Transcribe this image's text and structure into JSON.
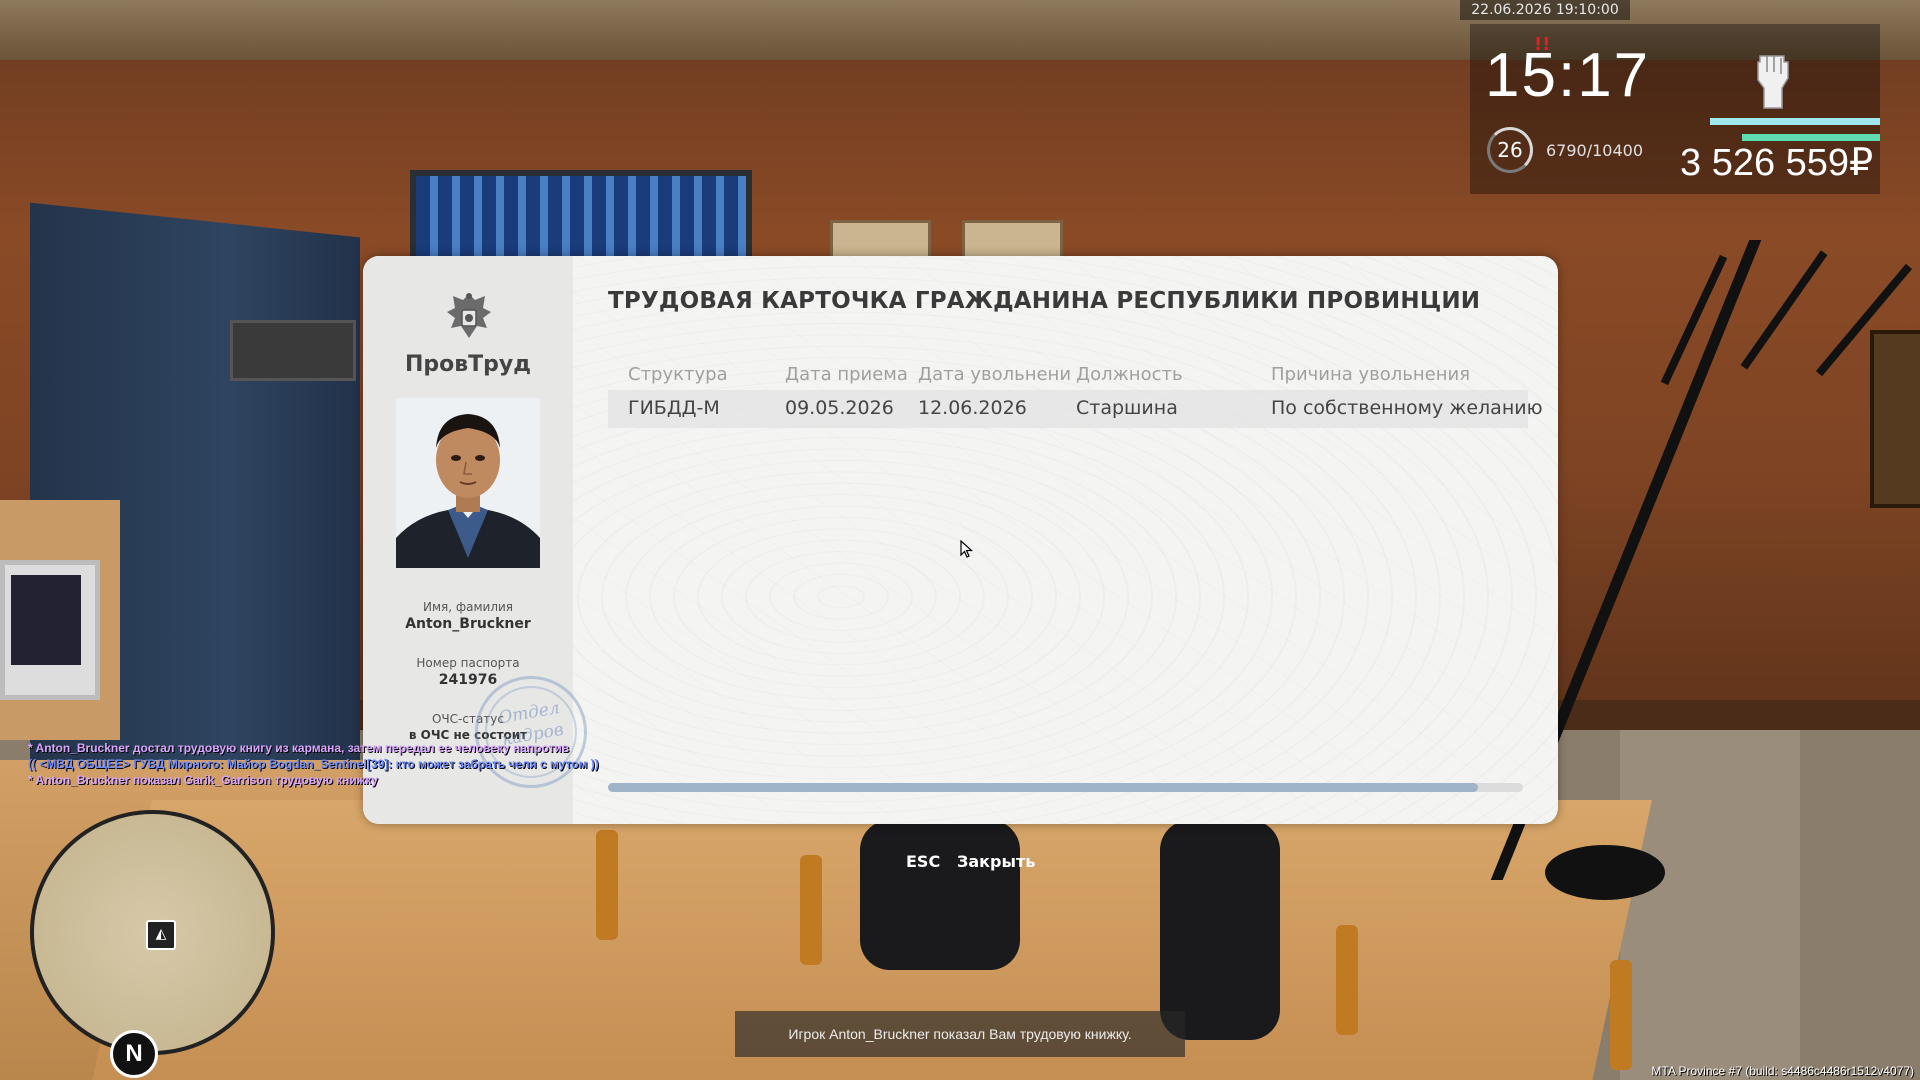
{
  "hud": {
    "datetime": "22.06.2026 19:10:00",
    "time": "15:17",
    "alert": "!!",
    "level": "26",
    "experience": "6790/10400",
    "money": "3 526 559₽",
    "colors": {
      "bar_top": "#9fe8f0",
      "bar_bottom": "#5fdcb0"
    }
  },
  "work_card": {
    "org_name": "ПровТруд",
    "title": "ТРУДОВАЯ КАРТОЧКА ГРАЖДАНИНА РЕСПУБЛИКИ ПРОВИНЦИИ",
    "name_label": "Имя, фамилия",
    "name_value": "Anton_Bruckner",
    "passport_label": "Номер паспорта",
    "passport_value": "241976",
    "status_label": "ОЧС-статус",
    "status_value": "в ОЧС не состоит",
    "stamp_line1": "Отдел",
    "stamp_line2": "кадров",
    "columns": [
      "Структура",
      "Дата приема",
      "Дата увольнени",
      "Должность",
      "Причина увольнения"
    ],
    "rows": [
      [
        "ГИБДД-М",
        "09.05.2026",
        "12.06.2026",
        "Старшина",
        "По собственному желанию"
      ]
    ]
  },
  "close_hint": {
    "key": "ESC",
    "label": "Закрыть"
  },
  "chat": [
    {
      "text": "* Anton_Bruckner достал трудовую книгу из кармана, затем передал ее человеку напротив",
      "color": "#d9a6ff"
    },
    {
      "text": "(( <МВД ОБЩЕЕ> ГУВД Мирного: Майор Bogdan_Sentinel[39]: кто может забрать челя с мутом ))",
      "color": "#6f8cff"
    },
    {
      "text": "* Anton_Bruckner показал Garik_Garrison трудовую книжку",
      "color": "#d9a6ff"
    }
  ],
  "minimap": {
    "north": "N",
    "player_glyph": "◭"
  },
  "notification": "Игрок Anton_Bruckner показал Вам трудовую книжку.",
  "build_info": "MTA Province #7 (build: s4486c4486r1512v4077)"
}
